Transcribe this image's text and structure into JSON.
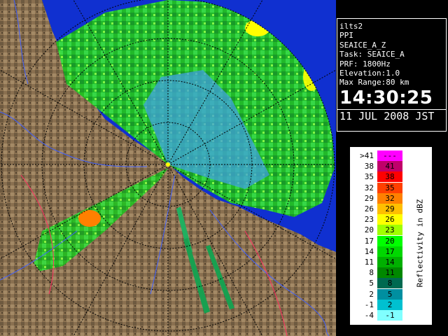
{
  "info": {
    "site": "ilts2",
    "scan_mode": "PPI",
    "product": "SEAICE_A_Z",
    "task": "Task: SEAICE_A",
    "prf": "PRF: 1800Hz",
    "elevation": "Elevation:1.0",
    "max_range": "Max Range:80 km",
    "time": "14:30:25",
    "date": "11 JUL 2008 JST"
  },
  "legend": {
    "unit_label": "Reflectivity in dBZ",
    "rows": [
      {
        "low": ">41",
        "high": "---",
        "color": "#ff00ff"
      },
      {
        "low": "38",
        "high": "41",
        "color": "#c0006a"
      },
      {
        "low": "35",
        "high": "38",
        "color": "#ff0000"
      },
      {
        "low": "32",
        "high": "35",
        "color": "#ff4000"
      },
      {
        "low": "29",
        "high": "32",
        "color": "#ff8000"
      },
      {
        "low": "26",
        "high": "29",
        "color": "#ffbf00"
      },
      {
        "low": "23",
        "high": "26",
        "color": "#ffff00"
      },
      {
        "low": "20",
        "high": "23",
        "color": "#a0ff00"
      },
      {
        "low": "17",
        "high": "20",
        "color": "#00ff00"
      },
      {
        "low": "14",
        "high": "17",
        "color": "#00d800"
      },
      {
        "low": "11",
        "high": "14",
        "color": "#00b000"
      },
      {
        "low": "8",
        "high": "11",
        "color": "#008800"
      },
      {
        "low": "5",
        "high": "8",
        "color": "#006a50"
      },
      {
        "low": "2",
        "high": "5",
        "color": "#008fa0"
      },
      {
        "low": "-1",
        "high": "2",
        "color": "#00c0d0"
      },
      {
        "low": "-4",
        "high": "-1",
        "color": "#80ffff"
      }
    ]
  },
  "map": {
    "sea_color": "#1030d0",
    "land_color": "#8a7050",
    "ring_color": "#000000",
    "river_color": "#4060ff",
    "boundary_color": "#ff3060"
  }
}
